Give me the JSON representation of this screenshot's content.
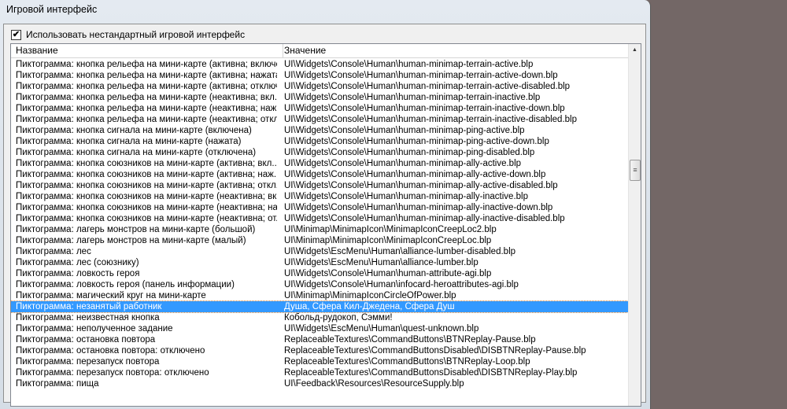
{
  "window": {
    "title": "Игровой интерфейс"
  },
  "checkbox": {
    "label": "Использовать нестандартный игровой интерфейс",
    "checked": true,
    "mark": "✔"
  },
  "table": {
    "columns": [
      "Название",
      "Значение"
    ],
    "selected_index": 22,
    "rows": [
      {
        "name": "Пиктограмма: кнопка рельефа на мини-карте (активна; включе...",
        "value": "UI\\Widgets\\Console\\Human\\human-minimap-terrain-active.blp"
      },
      {
        "name": "Пиктограмма: кнопка рельефа на мини-карте (активна; нажата)",
        "value": "UI\\Widgets\\Console\\Human\\human-minimap-terrain-active-down.blp"
      },
      {
        "name": "Пиктограмма: кнопка рельефа на мини-карте (активна; отключ...",
        "value": "UI\\Widgets\\Console\\Human\\human-minimap-terrain-active-disabled.blp"
      },
      {
        "name": "Пиктограмма: кнопка рельефа на мини-карте (неактивна; вкл...",
        "value": "UI\\Widgets\\Console\\Human\\human-minimap-terrain-inactive.blp"
      },
      {
        "name": "Пиктограмма: кнопка рельефа на мини-карте (неактивна; наж...",
        "value": "UI\\Widgets\\Console\\Human\\human-minimap-terrain-inactive-down.blp"
      },
      {
        "name": "Пиктограмма: кнопка рельефа на мини-карте (неактивна; откл...",
        "value": "UI\\Widgets\\Console\\Human\\human-minimap-terrain-inactive-disabled.blp"
      },
      {
        "name": "Пиктограмма: кнопка сигнала на мини-карте (включена)",
        "value": "UI\\Widgets\\Console\\Human\\human-minimap-ping-active.blp"
      },
      {
        "name": "Пиктограмма: кнопка сигнала на мини-карте (нажата)",
        "value": "UI\\Widgets\\Console\\Human\\human-minimap-ping-active-down.blp"
      },
      {
        "name": "Пиктограмма: кнопка сигнала на мини-карте (отключена)",
        "value": "UI\\Widgets\\Console\\Human\\human-minimap-ping-disabled.blp"
      },
      {
        "name": "Пиктограмма: кнопка союзников на мини-карте (активна; вкл...",
        "value": "UI\\Widgets\\Console\\Human\\human-minimap-ally-active.blp"
      },
      {
        "name": "Пиктограмма: кнопка союзников на мини-карте (активна; наж...",
        "value": "UI\\Widgets\\Console\\Human\\human-minimap-ally-active-down.blp"
      },
      {
        "name": "Пиктограмма: кнопка союзников на мини-карте (активна; откл...",
        "value": "UI\\Widgets\\Console\\Human\\human-minimap-ally-active-disabled.blp"
      },
      {
        "name": "Пиктограмма: кнопка союзников на мини-карте (неактивна; вк...",
        "value": "UI\\Widgets\\Console\\Human\\human-minimap-ally-inactive.blp"
      },
      {
        "name": "Пиктограмма: кнопка союзников на мини-карте (неактивна; на...",
        "value": "UI\\Widgets\\Console\\Human\\human-minimap-ally-inactive-down.blp"
      },
      {
        "name": "Пиктограмма: кнопка союзников на мини-карте (неактивна; от...",
        "value": "UI\\Widgets\\Console\\Human\\human-minimap-ally-inactive-disabled.blp"
      },
      {
        "name": "Пиктограмма: лагерь монстров на мини-карте (большой)",
        "value": "UI\\Minimap\\MinimapIcon\\MinimapIconCreepLoc2.blp"
      },
      {
        "name": "Пиктограмма: лагерь монстров на мини-карте (малый)",
        "value": "UI\\Minimap\\MinimapIcon\\MinimapIconCreepLoc.blp"
      },
      {
        "name": "Пиктограмма: лес",
        "value": "UI\\Widgets\\EscMenu\\Human\\alliance-lumber-disabled.blp"
      },
      {
        "name": "Пиктограмма: лес (союзнику)",
        "value": "UI\\Widgets\\EscMenu\\Human\\alliance-lumber.blp"
      },
      {
        "name": "Пиктограмма: ловкость героя",
        "value": "UI\\Widgets\\Console\\Human\\human-attribute-agi.blp"
      },
      {
        "name": "Пиктограмма: ловкость героя (панель информации)",
        "value": "UI\\Widgets\\Console\\Human\\infocard-heroattributes-agi.blp"
      },
      {
        "name": "Пиктограмма: магический круг на мини-карте",
        "value": "UI\\Minimap\\MinimapIconCircleOfPower.blp"
      },
      {
        "name": "Пиктограмма: незанятый работник",
        "value": "Душа, Сфера Кил-Джедена, Сфера Душ"
      },
      {
        "name": "Пиктограмма: неизвестная кнопка",
        "value": "Кобольд-рудокоп, Сэмми!"
      },
      {
        "name": "Пиктограмма: неполученное задание",
        "value": "UI\\Widgets\\EscMenu\\Human\\quest-unknown.blp"
      },
      {
        "name": "Пиктограмма: остановка повтора",
        "value": "ReplaceableTextures\\CommandButtons\\BTNReplay-Pause.blp"
      },
      {
        "name": "Пиктограмма: остановка повтора: отключено",
        "value": "ReplaceableTextures\\CommandButtonsDisabled\\DISBTNReplay-Pause.blp"
      },
      {
        "name": "Пиктограмма: перезапуск повтора",
        "value": "ReplaceableTextures\\CommandButtons\\BTNReplay-Loop.blp"
      },
      {
        "name": "Пиктограмма: перезапуск повтора: отключено",
        "value": "ReplaceableTextures\\CommandButtonsDisabled\\DISBTNReplay-Play.blp"
      },
      {
        "name": "Пиктограмма: пища",
        "value": "UI\\Feedback\\Resources\\ResourceSupply.blp"
      }
    ]
  },
  "scrollbar": {
    "position": 0.35,
    "up_arrow": "▲",
    "grip": "≡"
  }
}
